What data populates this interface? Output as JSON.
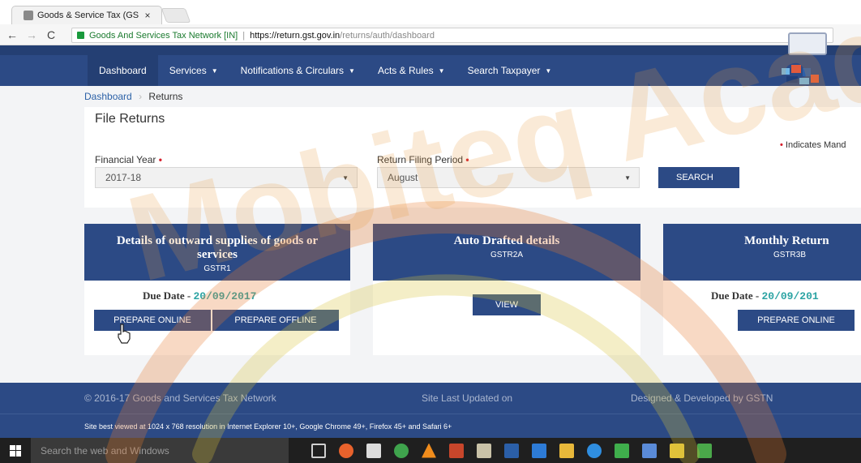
{
  "browser": {
    "tab_title": "Goods & Service Tax (GS",
    "tab_close": "×",
    "back": "←",
    "forward": "→",
    "reload": "C",
    "site_name": "Goods And Services Tax Network [IN]",
    "separator": "|",
    "url_scheme_host": "https://return.gst.gov.in",
    "url_path": "/returns/auth/dashboard"
  },
  "nav": {
    "items": [
      {
        "label": "Dashboard",
        "dropdown": false
      },
      {
        "label": "Services",
        "dropdown": true
      },
      {
        "label": "Notifications & Circulars",
        "dropdown": true
      },
      {
        "label": "Acts & Rules",
        "dropdown": true
      },
      {
        "label": "Search Taxpayer",
        "dropdown": true
      }
    ],
    "caret": "▼"
  },
  "breadcrumb": {
    "home": "Dashboard",
    "sep": "›",
    "current": "Returns"
  },
  "file_returns": {
    "title": "File Returns",
    "mandatory_marker": "•",
    "mandatory_note": "Indicates Mand",
    "financial_year_label": "Financial Year",
    "financial_year_value": "2017-18",
    "period_label": "Return Filing Period",
    "period_value": "August",
    "select_arrow": "▼",
    "search_label": "SEARCH"
  },
  "tiles": [
    {
      "title": "Details of outward supplies of goods or services",
      "code": "GSTR1",
      "due_label": "Due Date -",
      "due_date": "20/09/2017",
      "buttons": [
        "PREPARE ONLINE",
        "PREPARE OFFLINE"
      ]
    },
    {
      "title": "Auto Drafted details",
      "code": "GSTR2A",
      "buttons": [
        "VIEW"
      ]
    },
    {
      "title": "Monthly Return",
      "code": "GSTR3B",
      "due_label": "Due Date -",
      "due_date": "20/09/201",
      "buttons": [
        "PREPARE ONLINE"
      ]
    }
  ],
  "footer": {
    "copyright": "© 2016-17 Goods and Services Tax Network",
    "updated": "Site Last Updated on",
    "designed": "Designed & Developed by GSTN",
    "best_viewed": "Site best viewed at 1024 x 768 resolution in Internet Explorer 10+, Google Chrome 49+, Firefox 45+ and Safari 6+"
  },
  "taskbar": {
    "search_placeholder": "Search the web and Windows",
    "icons": [
      "task-view-icon",
      "firefox-icon",
      "store-icon",
      "chrome-icon",
      "vlc-icon",
      "powerpoint-icon",
      "media-icon",
      "word-icon",
      "mail-icon",
      "file-explorer-icon",
      "edge-icon",
      "green-app-icon",
      "blue-app-icon",
      "paint-icon",
      "green-app-2-icon"
    ]
  },
  "watermark_text": "Mobiteq Acad",
  "colors": {
    "nav_blue": "#2c4a85",
    "required_red": "#d61f2c",
    "due_date_teal": "#2ba3a3"
  }
}
